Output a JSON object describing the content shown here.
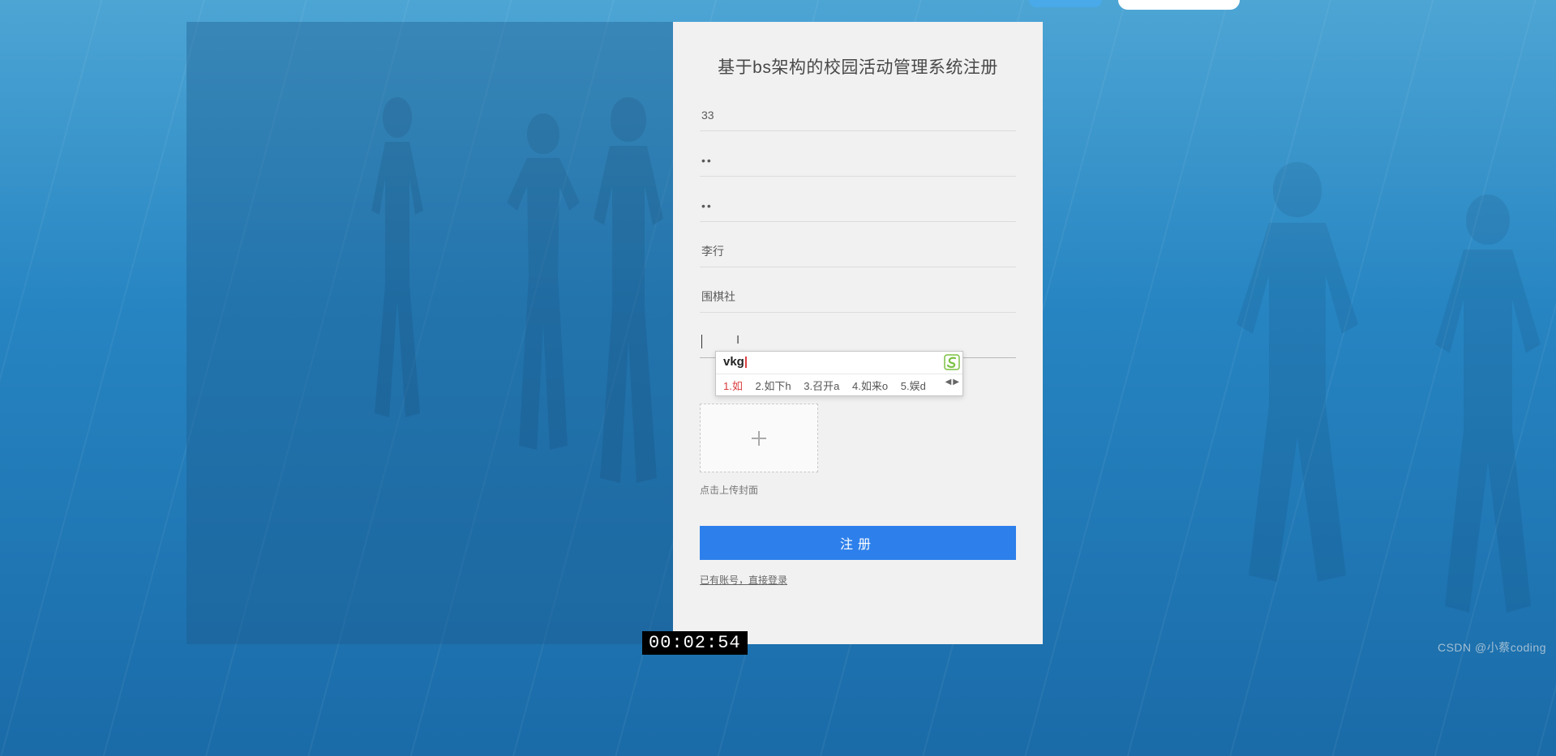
{
  "form": {
    "title": "基于bs架构的校园活动管理系统注册",
    "fields": {
      "username": "33",
      "password": "••",
      "confirm_password": "••",
      "name": "李行",
      "club": "围棋社",
      "extra": ""
    },
    "upload_label": "点击上传封面",
    "submit_label": "注册",
    "login_link": "已有账号，直接登录"
  },
  "ime": {
    "typed": "vkg",
    "candidates": [
      {
        "idx": "1",
        "text": "如",
        "suffix": ""
      },
      {
        "idx": "2",
        "text": "如下",
        "suffix": "h"
      },
      {
        "idx": "3",
        "text": "召开",
        "suffix": "a"
      },
      {
        "idx": "4",
        "text": "如来",
        "suffix": "o"
      },
      {
        "idx": "5",
        "text": "娱",
        "suffix": "d"
      }
    ]
  },
  "timestamp": "00:02:54",
  "watermark": "CSDN @小蔡coding"
}
